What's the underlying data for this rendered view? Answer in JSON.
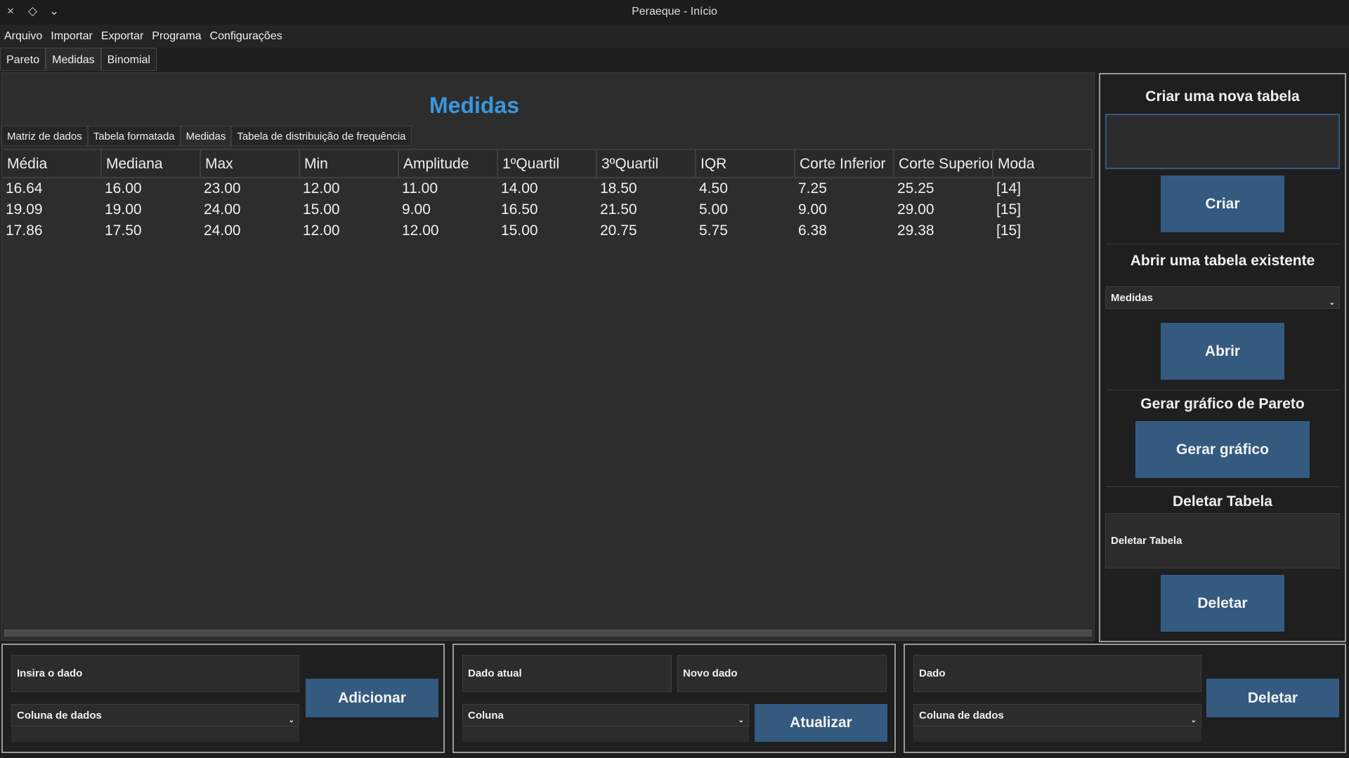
{
  "window": {
    "title": "Peraeque - Início",
    "controls": [
      "×",
      "◇",
      "⌄"
    ]
  },
  "menu": [
    "Arquivo",
    "Importar",
    "Exportar",
    "Programa",
    "Configurações"
  ],
  "tabs": [
    "Pareto",
    "Medidas",
    "Binomial"
  ],
  "main": {
    "title": "Medidas",
    "inner_tabs": [
      "Matriz de dados",
      "Tabela formatada",
      "Medidas",
      "Tabela de distribuição de frequência"
    ],
    "table": {
      "headers": [
        "Média",
        "Mediana",
        "Max",
        "Min",
        "Amplitude",
        "1ºQuartil",
        "3ºQuartil",
        "IQR",
        "Corte Inferior",
        "Corte Superior",
        "Moda"
      ],
      "rows": [
        [
          "16.64",
          "16.00",
          "23.00",
          "12.00",
          "11.00",
          "14.00",
          "18.50",
          "4.50",
          "7.25",
          "25.25",
          "[14]"
        ],
        [
          "19.09",
          "19.00",
          "24.00",
          "15.00",
          "9.00",
          "16.50",
          "21.50",
          "5.00",
          "9.00",
          "29.00",
          "[15]"
        ],
        [
          "17.86",
          "17.50",
          "24.00",
          "12.00",
          "12.00",
          "15.00",
          "20.75",
          "5.75",
          "6.38",
          "29.38",
          "[15]"
        ]
      ]
    }
  },
  "right": {
    "create_title": "Criar uma nova tabela",
    "create_placeholder": "",
    "create_button": "Criar",
    "open_title": "Abrir uma tabela existente",
    "open_selected": "Medidas",
    "open_button": "Abrir",
    "pareto_title": "Gerar gráfico de Pareto",
    "pareto_button": "Gerar gráfico",
    "delete_title": "Deletar Tabela",
    "delete_placeholder": "Deletar Tabela",
    "delete_button": "Deletar"
  },
  "bottom": {
    "add": {
      "input_placeholder": "Insira o dado",
      "column": "Coluna de dados",
      "button": "Adicionar"
    },
    "update": {
      "current_placeholder": "Dado atual",
      "new_placeholder": "Novo dado",
      "column": "Coluna",
      "button": "Atualizar"
    },
    "delete": {
      "input_placeholder": "Dado",
      "column": "Coluna de dados",
      "button": "Deletar"
    }
  }
}
